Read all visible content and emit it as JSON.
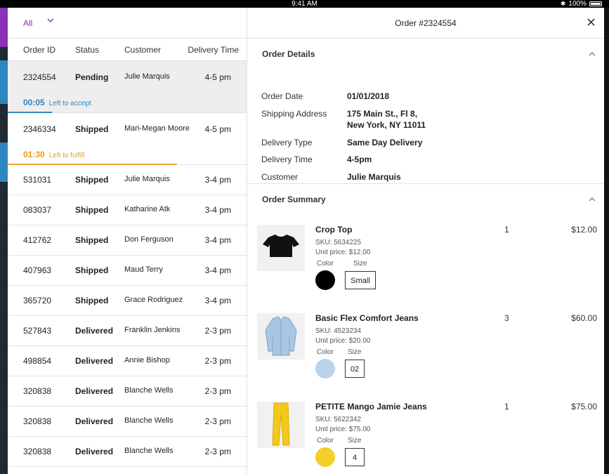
{
  "status_bar": {
    "time": "9:41 AM",
    "battery": "100%"
  },
  "filter": {
    "selected": "All"
  },
  "table": {
    "headers": [
      "Order ID",
      "Status",
      "Customer",
      "Delivery Time"
    ],
    "rows": [
      {
        "id": "2324554",
        "status": "Pending",
        "customer": "Julie Marquis",
        "time": "4-5 pm",
        "timer": "00:05",
        "timer_msg": "Left to accept"
      },
      {
        "id": "2346334",
        "status": "Shipped",
        "customer": "Mari-Megan Moore",
        "time": "4-5 pm",
        "timer": "01:30",
        "timer_msg": "Left to fulfill"
      },
      {
        "id": "531031",
        "status": "Shipped",
        "customer": "Julie Marquis",
        "time": "3-4 pm"
      },
      {
        "id": "083037",
        "status": "Shipped",
        "customer": "Katharine Atk",
        "time": "3-4 pm"
      },
      {
        "id": "412762",
        "status": "Shipped",
        "customer": "Don Ferguson",
        "time": "3-4 pm"
      },
      {
        "id": "407963",
        "status": "Shipped",
        "customer": "Maud Terry",
        "time": "3-4 pm"
      },
      {
        "id": "365720",
        "status": "Shipped",
        "customer": "Grace Rodriguez",
        "time": "3-4 pm"
      },
      {
        "id": "527843",
        "status": "Delivered",
        "customer": "Franklin Jenkins",
        "time": "2-3 pm"
      },
      {
        "id": "498854",
        "status": "Delivered",
        "customer": "Annie Bishop",
        "time": "2-3 pm"
      },
      {
        "id": "320838",
        "status": "Delivered",
        "customer": "Blanche Wells",
        "time": "2-3 pm"
      },
      {
        "id": "320838",
        "status": "Delivered",
        "customer": "Blanche Wells",
        "time": "2-3 pm"
      },
      {
        "id": "320838",
        "status": "Delivered",
        "customer": "Blanche Wells",
        "time": "2-3 pm"
      }
    ]
  },
  "detail": {
    "title": "Order #2324554",
    "order_details": {
      "heading": "Order Details",
      "fields": [
        {
          "label": "Order Date",
          "value": "01/01/2018"
        },
        {
          "label": "Shipping Address",
          "value": "175 Main St., Fl 8,",
          "value2": "New York, NY 11011"
        },
        {
          "label": "Delivery Type",
          "value": "Same Day Delivery"
        },
        {
          "label": "Delivery Time",
          "value": "4-5pm"
        },
        {
          "label": "Customer",
          "value": "Julie Marquis"
        }
      ]
    },
    "order_summary": {
      "heading": "Order Summary",
      "color_label": "Color",
      "size_label": "Size",
      "items": [
        {
          "name": "Crop Top",
          "sku": "SKU: 5634225",
          "unit_price": "Unit price: $12.00",
          "size": "Small",
          "qty": "1",
          "price": "$12.00",
          "color": "#000000"
        },
        {
          "name": "Basic Flex Comfort Jeans",
          "sku": "SKU: 4523234",
          "unit_price": "Unit price: $20.00",
          "size": "02",
          "qty": "3",
          "price": "$60.00",
          "color": "#b9d4ea"
        },
        {
          "name": "PETITE Mango Jamie Jeans",
          "sku": "SKU: 5622342",
          "unit_price": "Unit price: $75.00",
          "size": "4",
          "qty": "1",
          "price": "$75.00",
          "color": "#f4cf2c"
        }
      ]
    }
  },
  "colors": {
    "accent_purple": "#8a31b8",
    "timer_blue": "#2e86c1",
    "timer_orange": "#e89b1a"
  }
}
